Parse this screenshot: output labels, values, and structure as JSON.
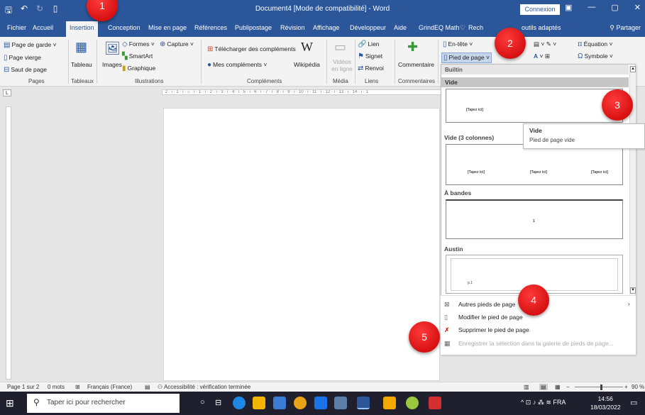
{
  "titlebar": {
    "title": "Document4 [Mode de compatibilité] - Word",
    "connexion": "Connexion",
    "minimize": "—",
    "restore": "▢",
    "close": "✕"
  },
  "tabs": {
    "items": [
      "Fichier",
      "Accueil",
      "Insertion",
      "Conception",
      "Mise en page",
      "Références",
      "Publipostage",
      "Révision",
      "Affichage",
      "Développeur",
      "Aide",
      "GrindEQ Math"
    ],
    "search_label_start": "Rech",
    "search_label_end": "outils adaptés",
    "share": "Partager"
  },
  "ribbon": {
    "page_de_garde": "Page de garde",
    "page_vierge": "Page vierge",
    "saut_de_page": "Saut de page",
    "tableau": "Tableau",
    "images": "Images",
    "formes": "Formes",
    "smartart": "SmartArt",
    "graphique": "Graphique",
    "capture": "Capture",
    "telecharger": "Télécharger des compléments",
    "mes_complements": "Mes compléments",
    "wikipedia": "Wikipédia",
    "videos": "Vidéos en ligne",
    "lien": "Lien",
    "signet": "Signet",
    "renvoi": "Renvoi",
    "commentaire": "Commentaire",
    "en_tete": "En-tête",
    "pied_de_page": "Pied de page",
    "equation": "Équation",
    "symbole": "Symbole",
    "groups": {
      "pages": "Pages",
      "tableaux": "Tableaux",
      "illustrations": "Illustrations",
      "complements": "Compléments",
      "media": "Média",
      "liens": "Liens",
      "commentaires": "Commentaires"
    }
  },
  "gallery": {
    "header": "Builtin",
    "categories": [
      "Vide",
      "Vide (3 colonnes)",
      "À bandes",
      "Austin"
    ],
    "placeholder": "[Tapez ici]",
    "page_number": "1",
    "austin_number": "p.1"
  },
  "tooltip": {
    "title": "Vide",
    "description": "Pied de page vide"
  },
  "menu": {
    "autres": "Autres pieds de page",
    "modifier": "Modifier le pied de page",
    "supprimer": "Supprimer le pied de page",
    "enregistrer": "Enregistrer la sélection dans la galerie de pieds de page..."
  },
  "statusbar": {
    "page": "Page 1 sur 2",
    "mots": "0 mots",
    "langue": "Français (France)",
    "accessibilite": "Accessibilité : vérification terminée",
    "zoom": "90 %"
  },
  "taskbar": {
    "search_placeholder": "Taper ici pour rechercher",
    "lang": "FRA",
    "time": "14:56",
    "date": "18/03/2022"
  },
  "markers": [
    "1",
    "2",
    "3",
    "4",
    "5"
  ],
  "colors": {
    "word_blue": "#2b579a",
    "marker_red": "#e00000"
  }
}
